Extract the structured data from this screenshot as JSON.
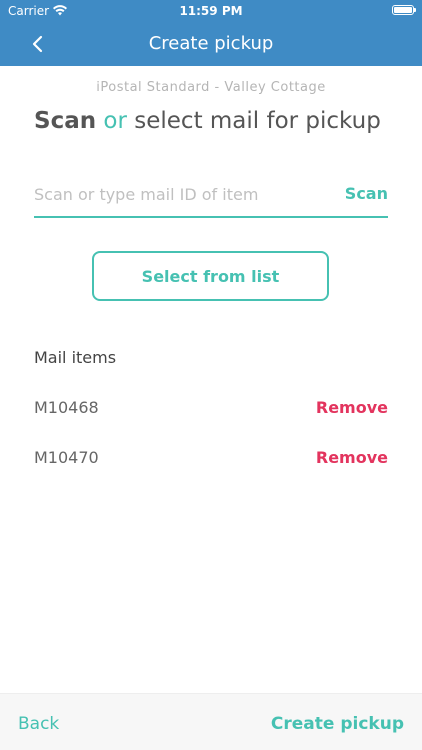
{
  "status_bar": {
    "carrier": "Carrier",
    "time": "11:59 PM",
    "wifi_icon": "wifi-icon",
    "battery_icon": "battery-icon"
  },
  "nav": {
    "title": "Create pickup",
    "back_icon": "chevron-left-icon"
  },
  "location": "iPostal Standard - Valley Cottage",
  "heading": {
    "scan": "Scan",
    "or": "or",
    "rest": "select mail for pickup"
  },
  "input": {
    "placeholder": "Scan or type mail ID of item",
    "value": "",
    "scan_label": "Scan"
  },
  "select_button": "Select from list",
  "mail_section": {
    "title": "Mail items",
    "items": [
      {
        "id": "M10468",
        "remove_label": "Remove"
      },
      {
        "id": "M10470",
        "remove_label": "Remove"
      }
    ]
  },
  "footer": {
    "back_label": "Back",
    "create_label": "Create pickup"
  },
  "colors": {
    "header": "#3f8bc5",
    "accent": "#46c1b2",
    "danger": "#e3345e"
  }
}
